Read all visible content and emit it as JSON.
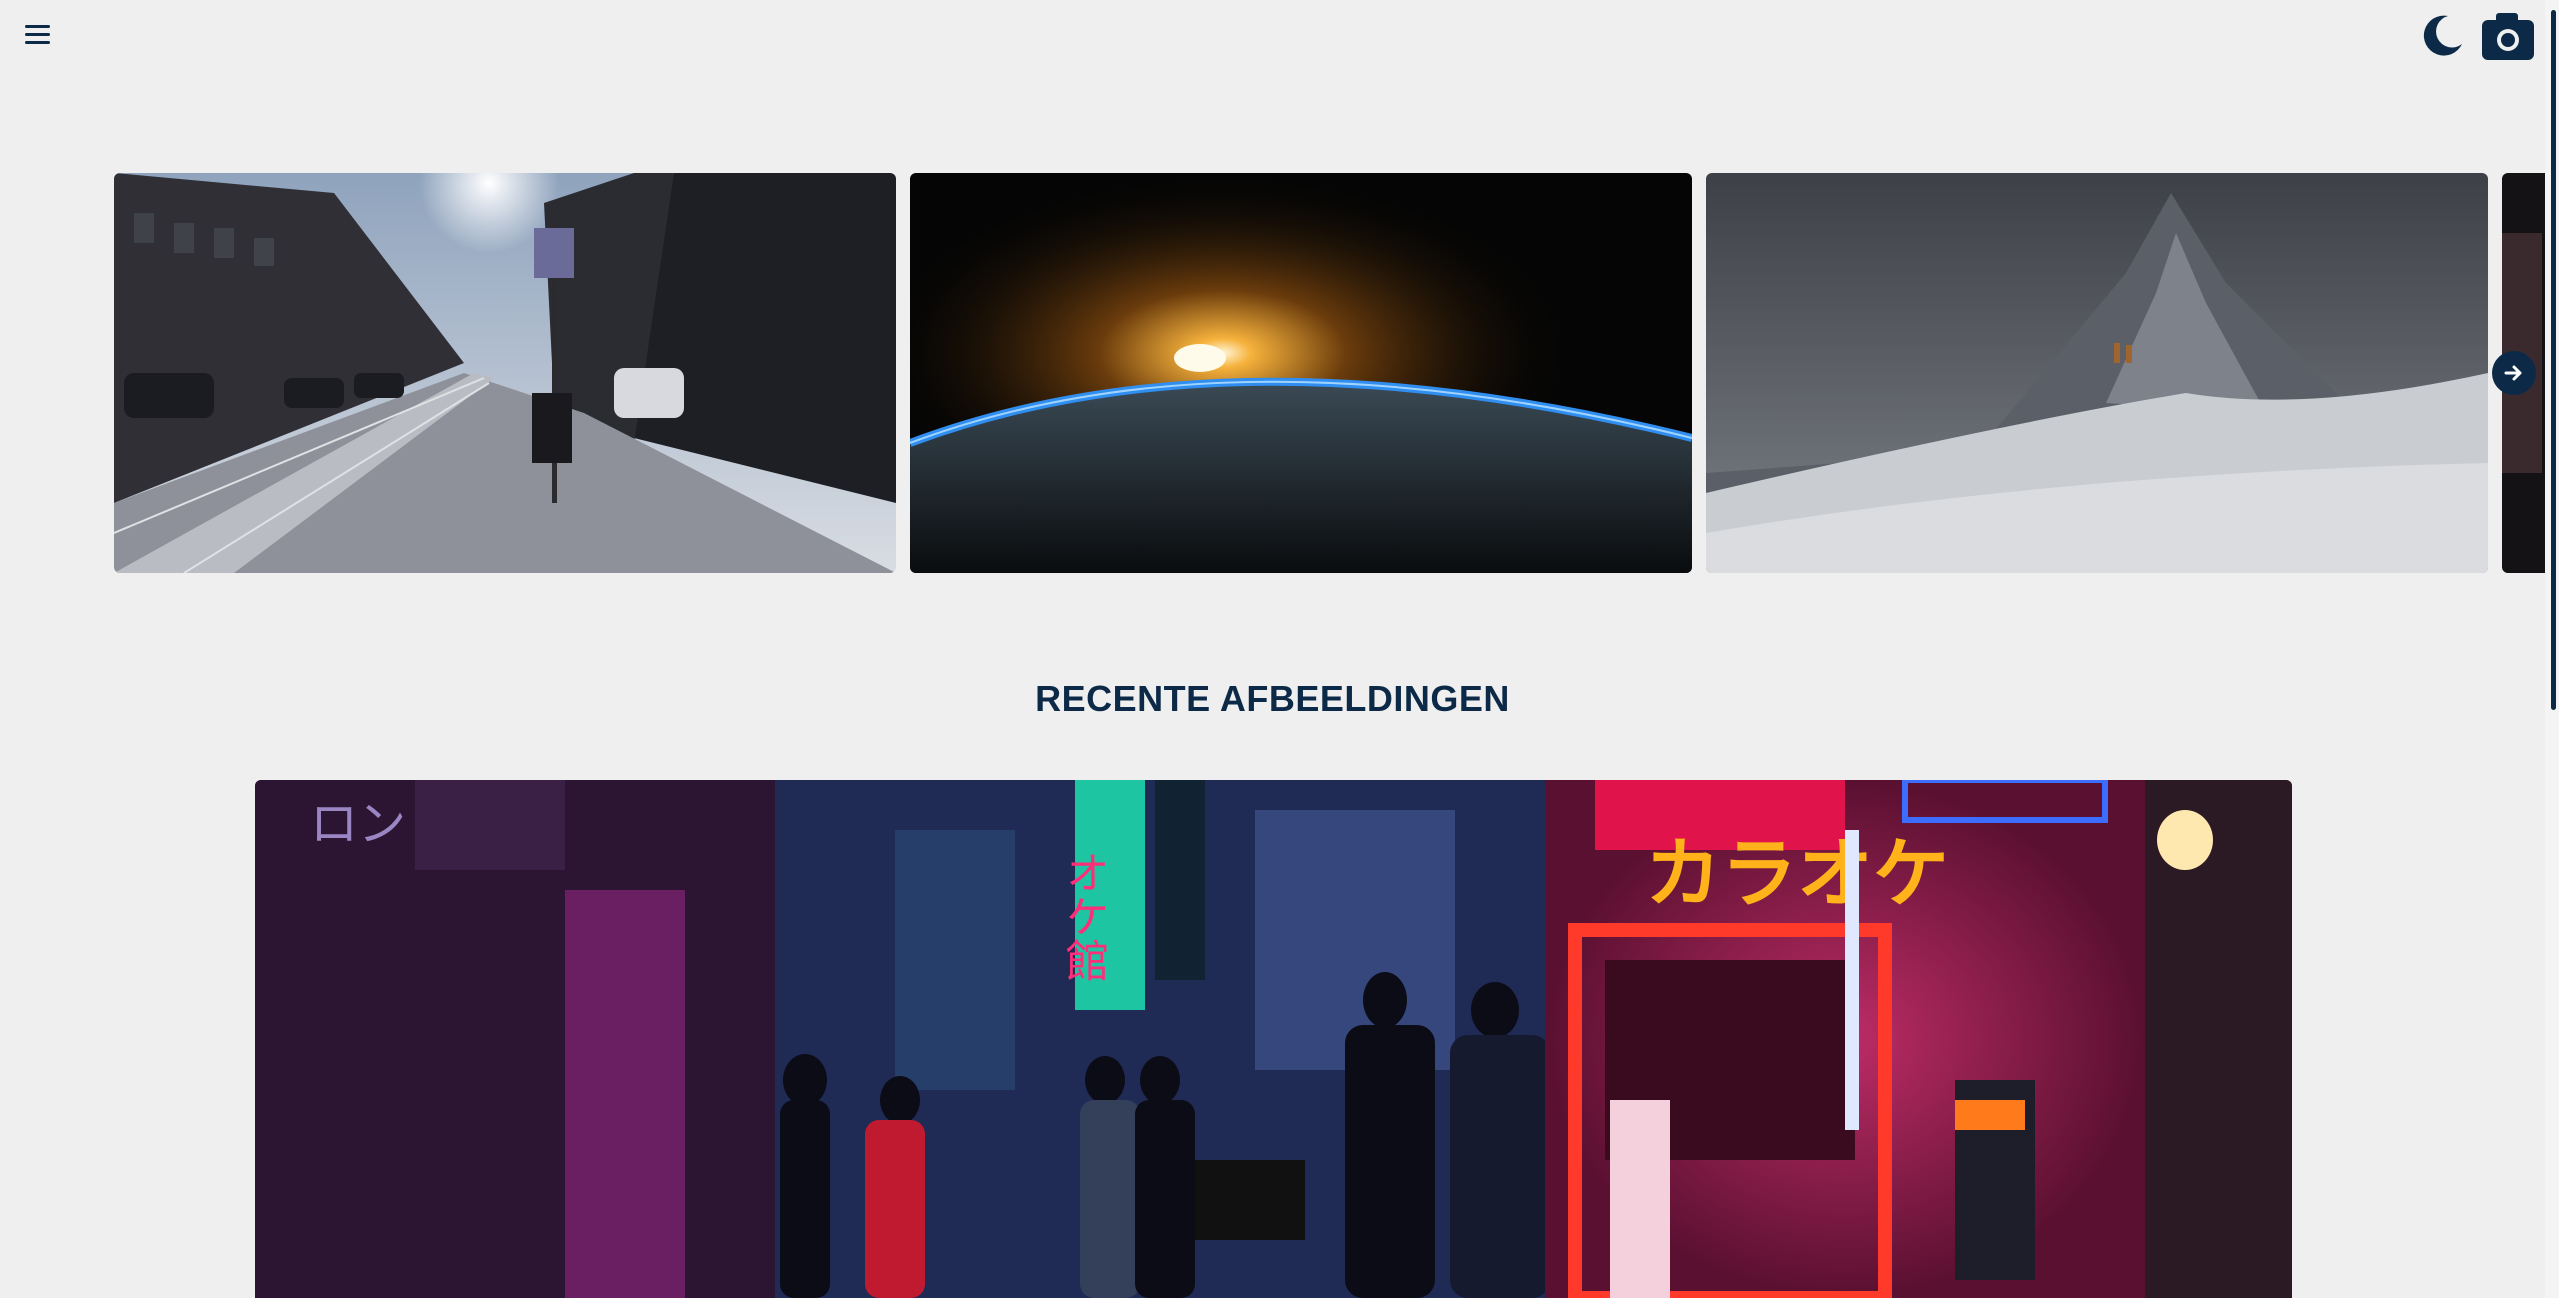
{
  "header": {
    "menu_icon": "hamburger-menu-icon",
    "theme_icon": "moon-icon",
    "camera_icon": "camera-icon"
  },
  "carousel": {
    "slides": [
      {
        "subject": "city-street-photo"
      },
      {
        "subject": "earth-sunrise-photo"
      },
      {
        "subject": "snowy-mountain-photo"
      },
      {
        "subject": "partial-photo"
      }
    ],
    "next_icon": "arrow-right-icon"
  },
  "recent": {
    "title": "RECENTE AFBEELDINGEN",
    "feature_subject": "neon-alley-karaoke-photo",
    "sign_text_1": "カラオケ",
    "sign_text_2": "オケ館"
  },
  "colors": {
    "accent": "#0c2a47",
    "background": "#efefef"
  }
}
